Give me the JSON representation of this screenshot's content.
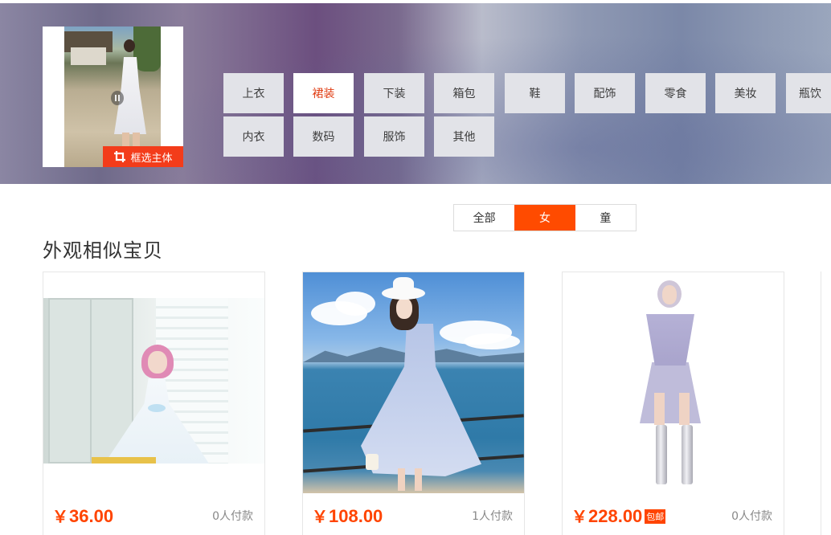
{
  "crop_button": {
    "label": "框选主体",
    "icon": "crop-icon"
  },
  "query_image": {
    "icon": "play-pause-icon"
  },
  "categories": [
    {
      "label": "上衣",
      "active": false
    },
    {
      "label": "裙装",
      "active": true
    },
    {
      "label": "下装",
      "active": false
    },
    {
      "label": "箱包",
      "active": false
    },
    {
      "label": "鞋",
      "active": false
    },
    {
      "label": "配饰",
      "active": false
    },
    {
      "label": "零食",
      "active": false
    },
    {
      "label": "美妆",
      "active": false
    },
    {
      "label": "瓶饮",
      "active": false
    },
    {
      "label": "内衣",
      "active": false
    },
    {
      "label": "数码",
      "active": false
    },
    {
      "label": "服饰",
      "active": false
    },
    {
      "label": "其他",
      "active": false
    }
  ],
  "gender_tabs": [
    {
      "label": "全部",
      "active": false
    },
    {
      "label": "女",
      "active": true
    },
    {
      "label": "童",
      "active": false
    }
  ],
  "section_title": "外观相似宝贝",
  "products": [
    {
      "currency": "￥",
      "price": "36.00",
      "payers": "0人付款",
      "badge": ""
    },
    {
      "currency": "￥",
      "price": "108.00",
      "payers": "1人付款",
      "badge": ""
    },
    {
      "currency": "￥",
      "price": "228.00",
      "payers": "0人付款",
      "badge": "包邮"
    }
  ],
  "colors": {
    "accent": "#ff4400",
    "crop_button": "#f33c1a",
    "active_category_text": "#e03c12",
    "active_tab": "#ff4b00"
  }
}
